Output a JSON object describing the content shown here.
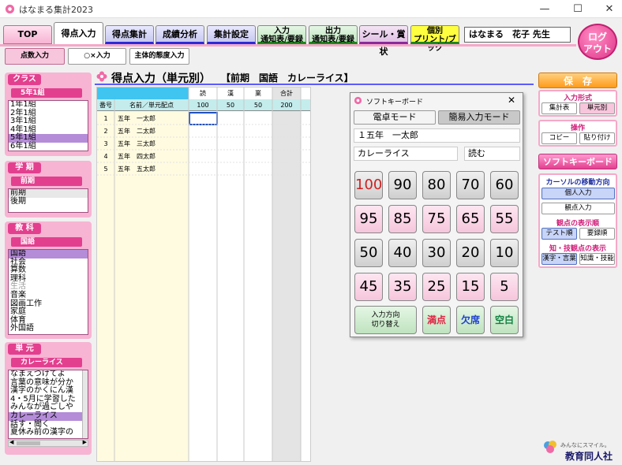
{
  "window": {
    "title": "はなまる集計2023",
    "min": "—",
    "max": "☐",
    "close": "✕"
  },
  "nav": {
    "top": "TOP",
    "tokuten": "得点入力",
    "shukei": "得点集計",
    "seiseki": "成績分析",
    "settings": "集計設定",
    "input_l1": "入力",
    "input_l2": "通知表/要録",
    "output_l1": "出力",
    "output_l2": "通知表/要録",
    "seal": "シール・賞状",
    "print_l1": "個別",
    "print_l2": "プリント/ブック",
    "teacher": "はなまる　花子 先生",
    "logout_l1": "ログ",
    "logout_l2": "アウト"
  },
  "subtabs": {
    "score": "点数入力",
    "ox": "○×入力",
    "attitude": "主体的態度入力"
  },
  "left": {
    "class_head": "クラス",
    "class_sub": "5年1組",
    "classes": [
      "1年1組",
      "2年1組",
      "3年1組",
      "4年1組",
      "5年1組",
      "6年1組"
    ],
    "term_head": "学 期",
    "term_sub": "前期",
    "terms": [
      "前期",
      "後期"
    ],
    "subject_head": "教 科",
    "subject_sub": "国語",
    "subjects": [
      "国語",
      "社会",
      "算数",
      "理科",
      "生活",
      "音楽",
      "図画工作",
      "家庭",
      "体育",
      "外国語"
    ],
    "unit_head": "単 元",
    "unit_sub": "カレーライス",
    "units": [
      "なまえつけてよ",
      "言葉の意味が分か",
      "漢字のかくにん漢",
      "4・5月に学習した",
      "みんなが過ごしや",
      "カレーライス",
      "話す・聞く",
      "夏休み前の漢字の"
    ]
  },
  "main": {
    "title": "得点入力（単元別）",
    "context": "【前期　国語　カレーライス】",
    "col_headers": [
      "読",
      "漢",
      "業",
      "合計"
    ],
    "col_max": [
      "100",
      "50",
      "50",
      "200"
    ],
    "col_no": "番号",
    "col_name": "名前／単元配点",
    "students": [
      {
        "no": "1",
        "name": "五年　一太郎"
      },
      {
        "no": "2",
        "name": "五年　二太郎"
      },
      {
        "no": "3",
        "name": "五年　三太郎"
      },
      {
        "no": "4",
        "name": "五年　四太郎"
      },
      {
        "no": "5",
        "name": "五年　五太郎"
      }
    ]
  },
  "keyboard": {
    "title": "ソフトキーボード",
    "close": "✕",
    "mode_dentaku": "電卓モード",
    "mode_kani": "簡易入力モード",
    "student": "１五年　一太郎",
    "unit": "カレーライス",
    "aspect": "読む",
    "keys": [
      "100",
      "90",
      "80",
      "70",
      "60",
      "95",
      "85",
      "75",
      "65",
      "55",
      "50",
      "40",
      "30",
      "20",
      "10",
      "45",
      "35",
      "25",
      "15",
      "5"
    ],
    "direction_l1": "入力方向",
    "direction_l2": "切り替え",
    "full": "満点",
    "absent": "欠席",
    "blank": "空白"
  },
  "right": {
    "save": "保　存",
    "input_form": "入力形式",
    "summary_table": "集計表",
    "unit_based": "単元別",
    "operation": "操作",
    "copy": "コピー",
    "paste": "貼り付け",
    "soft_keyboard": "ソフトキーボード",
    "cursor_dir": "カーソルの移動方向",
    "by_student": "個人入力",
    "by_aspect": "観点入力",
    "aspect_order": "観点の表示順",
    "test_order": "テスト順",
    "record_order": "要録順",
    "knowledge_display": "知・技観点の表示",
    "kanji_lang": "漢字・言葉",
    "knowledge_skill": "知識・技能"
  },
  "footer": {
    "tag": "みんなにスマイル。",
    "company": "教育同人社"
  }
}
